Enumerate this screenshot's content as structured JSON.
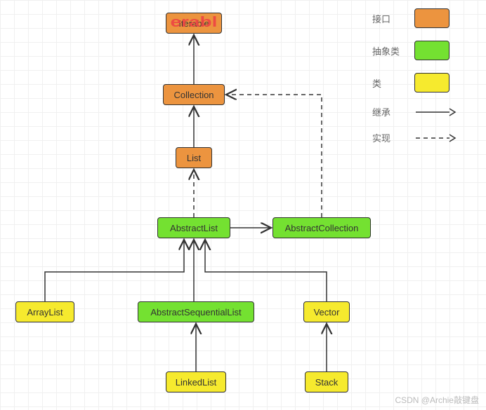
{
  "nodes": {
    "iterable": {
      "label": "Iterable",
      "type": "interface"
    },
    "collection": {
      "label": "Collection",
      "type": "interface"
    },
    "list": {
      "label": "List",
      "type": "interface"
    },
    "abstractList": {
      "label": "AbstractList",
      "type": "abstract"
    },
    "abstractCollection": {
      "label": "AbstractCollection",
      "type": "abstract"
    },
    "abstractSequentialList": {
      "label": "AbstractSequentialList",
      "type": "abstract"
    },
    "arrayList": {
      "label": "ArrayList",
      "type": "class"
    },
    "vector": {
      "label": "Vector",
      "type": "class"
    },
    "linkedList": {
      "label": "LinkedList",
      "type": "class"
    },
    "stack": {
      "label": "Stack",
      "type": "class"
    }
  },
  "edges": [
    {
      "from": "collection",
      "to": "iterable",
      "style": "solid"
    },
    {
      "from": "list",
      "to": "collection",
      "style": "solid"
    },
    {
      "from": "abstractList",
      "to": "list",
      "style": "dashed"
    },
    {
      "from": "abstractList",
      "to": "abstractCollection",
      "style": "solid",
      "dir": "right"
    },
    {
      "from": "abstractCollection",
      "to": "collection",
      "style": "dashed"
    },
    {
      "from": "arrayList",
      "to": "abstractList",
      "style": "solid"
    },
    {
      "from": "abstractSequentialList",
      "to": "abstractList",
      "style": "solid"
    },
    {
      "from": "vector",
      "to": "abstractList",
      "style": "solid"
    },
    {
      "from": "linkedList",
      "to": "abstractSequentialList",
      "style": "solid"
    },
    {
      "from": "stack",
      "to": "vector",
      "style": "solid"
    }
  ],
  "legend": {
    "interface": "接口",
    "abstract": "抽象类",
    "class": "类",
    "inherit": "继承",
    "implement": "实现"
  },
  "colors": {
    "interface": "#ec943f",
    "abstract": "#74e131",
    "class": "#f6ea2e"
  },
  "watermark": "CSDN @Archie敲键盘",
  "stamp_text": "erabl"
}
